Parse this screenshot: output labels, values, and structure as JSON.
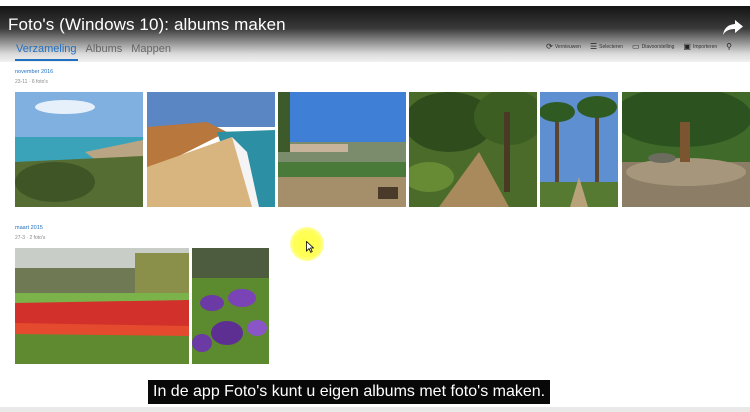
{
  "video": {
    "title": "Foto's (Windows 10): albums maken"
  },
  "nav": {
    "tabs": [
      "Verzameling",
      "Albums",
      "Mappen"
    ],
    "active_tab": "Verzameling"
  },
  "toolbar": {
    "items": [
      {
        "label": "Vernieuwen",
        "icon": "refresh-icon"
      },
      {
        "label": "Selecteren",
        "icon": "select-icon"
      },
      {
        "label": "Diavoorstelling",
        "icon": "slideshow-icon"
      },
      {
        "label": "Importeren",
        "icon": "import-icon"
      },
      {
        "label": "",
        "icon": "more-icon"
      }
    ]
  },
  "groups": [
    {
      "date": "november 2016",
      "meta": "23-11 · 6 foto's",
      "photos": [
        "coastline",
        "beach-cliffs",
        "harbor-town",
        "forest-path",
        "palm-avenue",
        "park-statue"
      ]
    },
    {
      "date": "maart 2015",
      "meta": "27-3 · 2 foto's",
      "photos": [
        "tulip-field",
        "purple-crocus"
      ]
    }
  ],
  "subtitle": "In de app Foto's kunt u eigen albums met foto's maken.",
  "colors": {
    "accent": "#1f6fc1",
    "subtitle_bg": "#080808",
    "cursor_highlight": "#ffff3c"
  }
}
